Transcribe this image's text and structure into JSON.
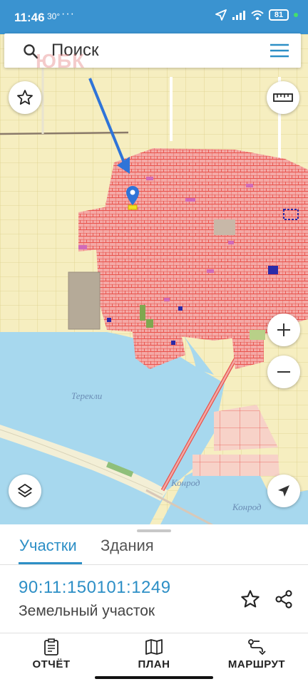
{
  "status_bar": {
    "time": "11:46",
    "temperature": "30°",
    "more": "···",
    "battery": "81"
  },
  "search": {
    "placeholder": "Поиск"
  },
  "watermark": "ЮБК",
  "map": {
    "labels": {
      "town": "Терекли",
      "road_1": "Конрод",
      "road_2": "Конрод"
    },
    "colors": {
      "land": "#f6eec0",
      "water": "#a7d8ee",
      "parcel_fill": "#f4a9a6",
      "parcel_stroke": "#e8524b",
      "annotation_arrow": "#2f74d8"
    }
  },
  "tabs": {
    "parcels": "Участки",
    "buildings": "Здания"
  },
  "parcel": {
    "cadastral_number": "90:11:150101:1249",
    "type": "Земельный участок"
  },
  "actions": {
    "report": "ОТЧЁТ",
    "plan": "ПЛАН",
    "route": "МАРШРУТ"
  }
}
